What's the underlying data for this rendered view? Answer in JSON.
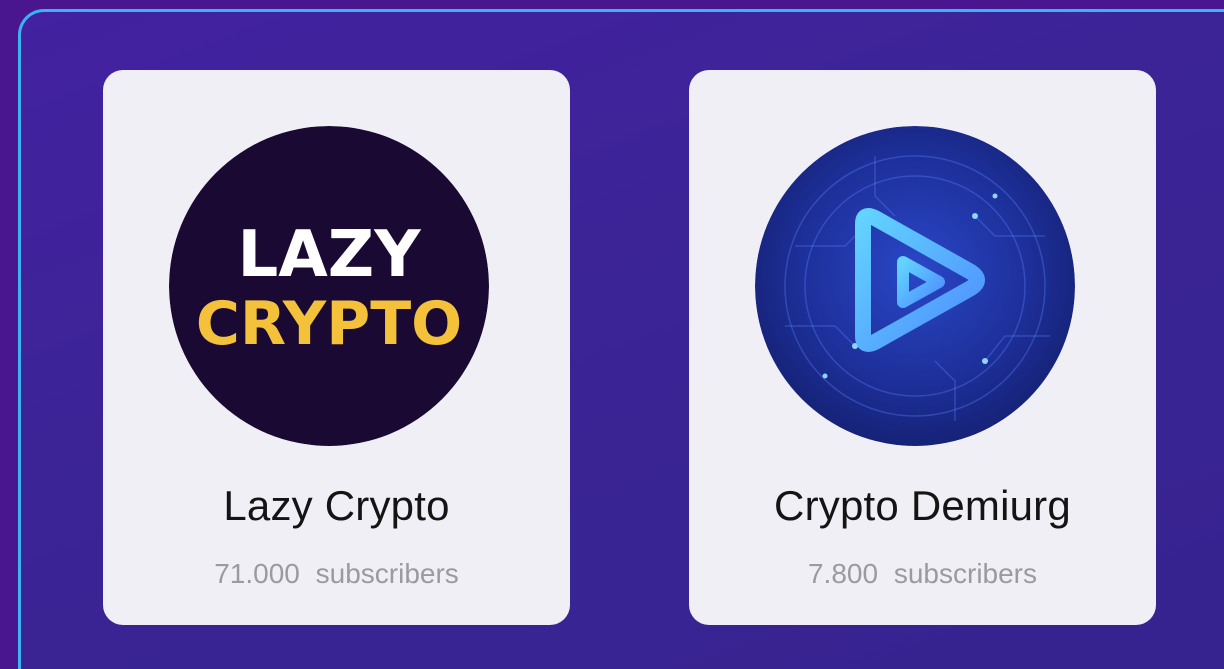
{
  "channels": [
    {
      "name": "Lazy Crypto",
      "subscriber_count": "71.000",
      "subscriber_label": "subscribers",
      "logo_text_line1": "LAZY",
      "logo_text_line2": "CRYPTO",
      "logo_bg": "#1a0a33",
      "logo_color_1": "#ffffff",
      "logo_color_2": "#f3c23a"
    },
    {
      "name": "Crypto Demiurg",
      "subscriber_count": "7.800",
      "subscriber_label": "subscribers",
      "logo_icon": "play-icon",
      "logo_bg": "#1b2a8c",
      "logo_accent": "#5fb6ff"
    }
  ],
  "colors": {
    "frame_border": "#39b4f0",
    "card_bg": "#efeff5",
    "text_primary": "#141414",
    "text_secondary": "#9a9aa2"
  }
}
